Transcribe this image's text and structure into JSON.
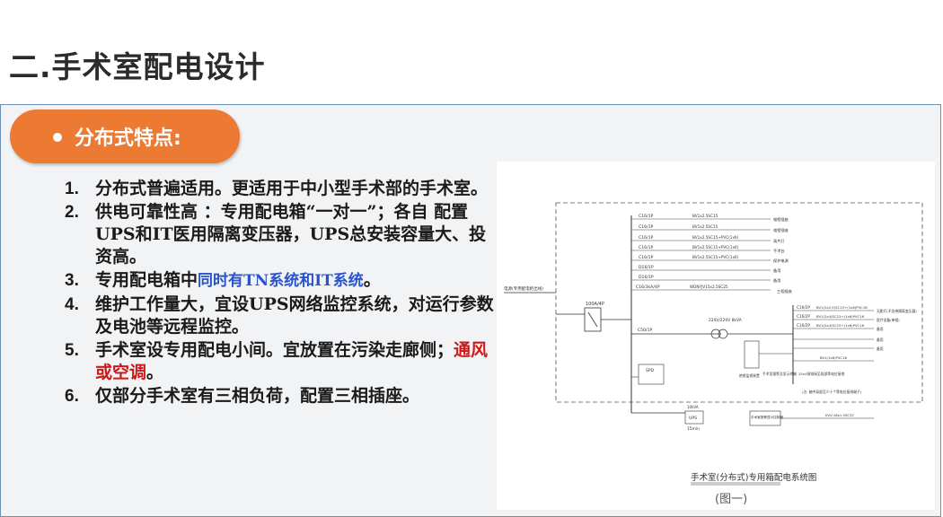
{
  "slide": {
    "title": "二.手术室配电设计",
    "section_label": "分布式特点:"
  },
  "points": [
    {
      "num": "1.",
      "text": "分布式普遍适用。更适用于中小型手术部的手术室。"
    },
    {
      "num": "2.",
      "text": "供电可靠性高  ：专用配电箱“一对一”；各自 配置UPS和IT医用隔离变压器，UPS总安装容量大、投资高。"
    },
    {
      "num": "3.",
      "text_a": "专用配电箱中",
      "text_b": "同时有TN系统和IT系统",
      "text_c": "。"
    },
    {
      "num": "4.",
      "text": "维护工作量大，宜设UPS网络监控系统，对运行参数及电池等远程监控。"
    },
    {
      "num": "5.",
      "text_a": "手术室设专用配电小间。宜放置在污染走廊侧；",
      "text_b": "通风或空调",
      "text_c": "。"
    },
    {
      "num": "6.",
      "text": "仅部分手术室有三相负荷，配置三相插座。"
    }
  ],
  "diagram": {
    "caption": "手术室(分布式)专用箱配电系统图",
    "figure_label": "(图一)",
    "breakers_tn": [
      "C16/1P",
      "C16/1P",
      "C16/1P",
      "C16/1P",
      "C16/1P",
      "D16/1P",
      "D16/1P",
      "C16/3kA/4P"
    ],
    "cables_tn": [
      "BV1x2.5SC15",
      "BV1x2.5SC15",
      "BV1x2.5SC15+PVC(1x6)",
      "BV1x2.5SC15+PVC(1x6)",
      "BV1x2.5SC15+PVC(1x6)",
      "",
      "",
      "WDNYJV15x2.5SC25"
    ],
    "loads_tn": [
      "电壁插座",
      "电壁插座",
      "观片灯",
      "手术台",
      "保护电源",
      "备用",
      "备用",
      "三相插座"
    ],
    "main_breaker": "100A/4P",
    "ups_breaker": "C50/1P",
    "transformer": "220V/220V 8kVA",
    "incoming_label": "电源(专用配电柜出线)",
    "spd_label": "SPD",
    "ups_box": "UPS",
    "ups_note": "15min",
    "ups_rating": "10kVA",
    "it_breakers": [
      "C16/2P",
      "C16/2P",
      "C16/2P",
      "C16/2P"
    ],
    "it_cables": [
      "BV1(2x2.5)SC15+(1x6)PVC16",
      "BV1(2x4)SC15+(1x6)PVC16",
      "BV1(2x4)SC15+(1x6)PVC16",
      "BV1(1x6)PVC16"
    ],
    "it_loads": [
      "无影灯(不含带隔离变压器)",
      "医疗设备(单相)",
      "备用",
      "备用",
      "备用"
    ],
    "monitor_label": "绝缘监视装置",
    "terminal_label": "手术室报警及显示终端",
    "ground_note": "25x4铜排接至局部等电位接地",
    "bottom_note": "(注: 箱中局部至少十个等电位接线端子)",
    "alarm_box": "手术室报警显示控制器",
    "alarm_cable": "KVV-16x1.5SC32"
  }
}
